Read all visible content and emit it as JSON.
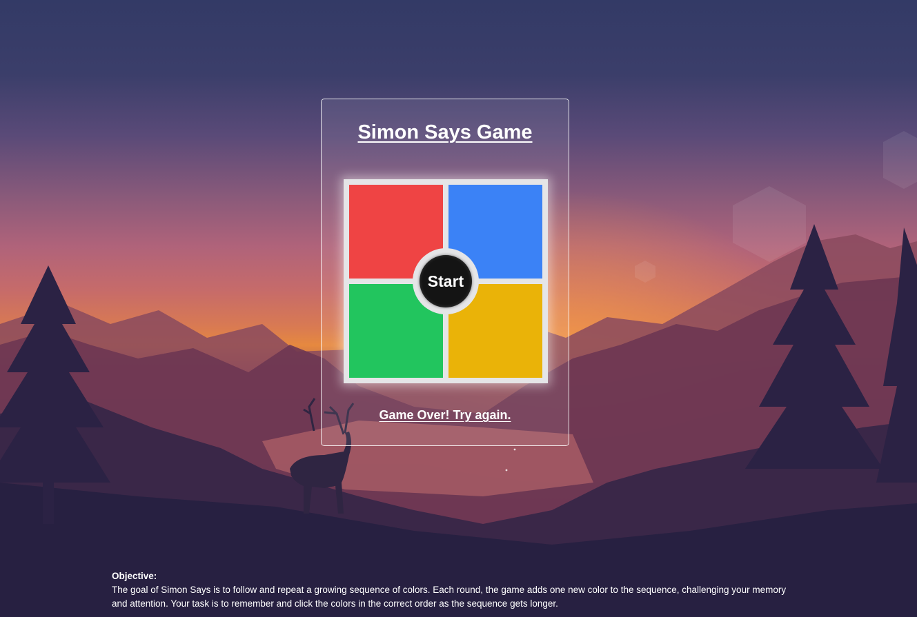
{
  "game": {
    "title": "Simon Says Game",
    "start_label": "Start",
    "status_message": "Game Over! Try again.",
    "pads": [
      {
        "color_name": "red",
        "hex": "#ef4444"
      },
      {
        "color_name": "blue",
        "hex": "#3b82f6"
      },
      {
        "color_name": "green",
        "hex": "#22c55e"
      },
      {
        "color_name": "yellow",
        "hex": "#eab308"
      }
    ]
  },
  "objective": {
    "label": "Objective:",
    "text": "The goal of Simon Says is to follow and repeat a growing sequence of colors. Each round, the game adds one new color to the sequence, challenging your memory and attention. Your task is to remember and click the colors in the correct order as the sequence gets longer."
  },
  "background": {
    "description_icons": [
      "mountain-landscape",
      "pine-trees",
      "deer-silhouette",
      "sunset"
    ]
  }
}
